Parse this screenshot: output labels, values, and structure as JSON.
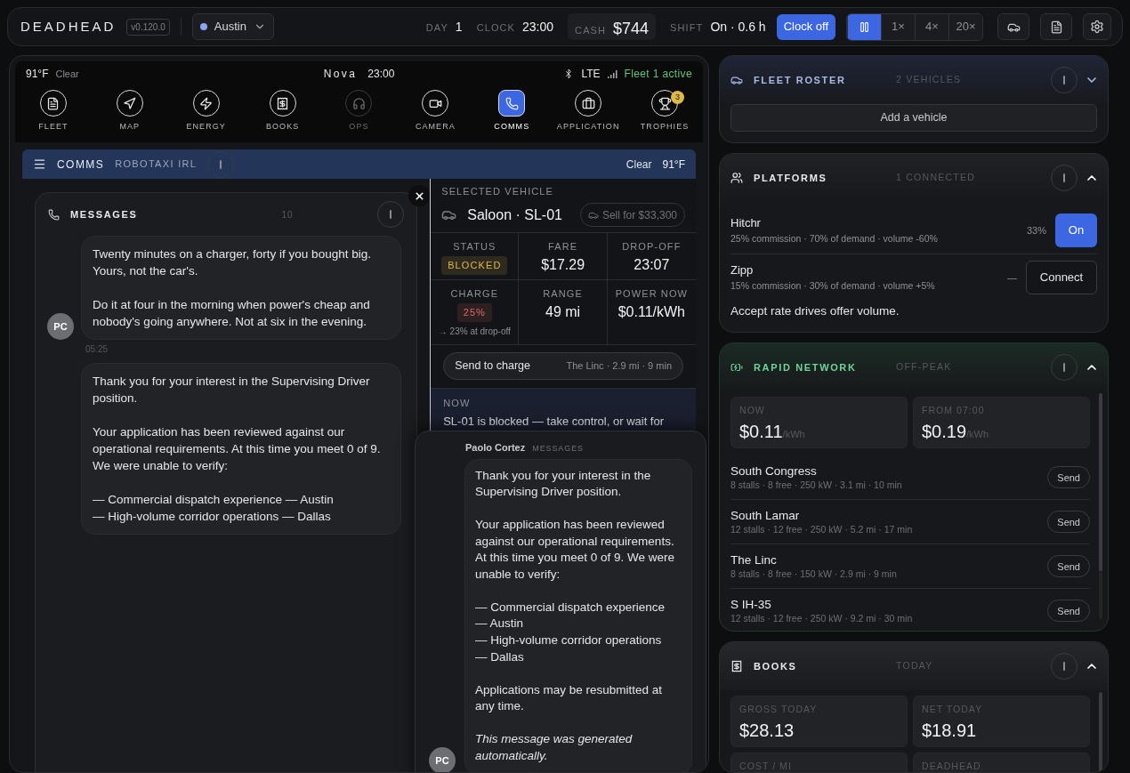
{
  "app": {
    "name": "DEADHEAD",
    "version": "v0.120.0"
  },
  "city": {
    "name": "Austin",
    "color": "#8aa4f8"
  },
  "stats": [
    {
      "kind": "plain",
      "label": "DAY",
      "value": "1"
    },
    {
      "kind": "plain",
      "label": "CLOCK",
      "value": "23:00"
    },
    {
      "kind": "boxed",
      "label": "CASH",
      "value": "$744"
    },
    {
      "kind": "plain",
      "label": "SHIFT",
      "value": "On · 0.6 h"
    }
  ],
  "clock_button": "Clock off",
  "speeds": [
    {
      "kind": "pause",
      "selected": true
    },
    {
      "kind": "rate",
      "label": "1×",
      "selected": false
    },
    {
      "kind": "rate",
      "label": "4×",
      "selected": false
    },
    {
      "kind": "rate",
      "label": "20×",
      "selected": false
    }
  ],
  "status_bar": {
    "temp": "91°F",
    "weather": "Clear",
    "carrier": "Nova",
    "time": "23:00",
    "network": "LTE",
    "fleet": "Fleet 1 active"
  },
  "nav": [
    {
      "kind": "fleet",
      "label": "FLEET",
      "selected": false,
      "disabled": false
    },
    {
      "kind": "map",
      "label": "MAP",
      "selected": false,
      "disabled": false
    },
    {
      "kind": "energy",
      "label": "ENERGY",
      "selected": false,
      "disabled": false
    },
    {
      "kind": "books",
      "label": "BOOKS",
      "selected": false,
      "disabled": false
    },
    {
      "kind": "ops",
      "label": "OPS",
      "selected": false,
      "disabled": true
    },
    {
      "kind": "camera",
      "label": "CAMERA",
      "selected": false,
      "disabled": false
    },
    {
      "kind": "comms",
      "label": "COMMS",
      "selected": true,
      "disabled": false
    },
    {
      "kind": "application",
      "label": "APPLICATION",
      "selected": false,
      "disabled": false
    },
    {
      "kind": "trophies",
      "label": "TROPHIES",
      "selected": false,
      "disabled": false,
      "badge": "3"
    }
  ],
  "section_bar": {
    "title": "COMMS",
    "subtitle": "ROBOTAXI IRL",
    "weather": "Clear",
    "temp": "91°F"
  },
  "messages": {
    "title": "MESSAGES",
    "count": "10",
    "items": [
      {
        "paragraphs": [
          "Twenty minutes on a charger, forty if you bought big. Yours, not the car's.",
          "Do it at four in the morning when power's cheap and nobody's going anywhere. Not at six in the evening."
        ],
        "avatar": "PC",
        "time": "05:25"
      },
      {
        "paragraphs": [
          "Thank you for your interest in the Supervising Driver position.",
          "Your application has been reviewed against our operational requirements. At this time you meet 0 of 9. We were unable to verify:",
          "— Commercial dispatch experience — Austin\n— High-volume corridor operations — Dallas"
        ]
      }
    ]
  },
  "vehicle": {
    "heading": "SELECTED VEHICLE",
    "name": "Saloon · SL-01",
    "sell": "Sell for $33,300",
    "stats": [
      {
        "kind": "badge",
        "label": "STATUS",
        "value": "BLOCKED",
        "color": "#e0b84a"
      },
      {
        "kind": "value",
        "label": "FARE",
        "value": "$17.29"
      },
      {
        "kind": "value",
        "label": "DROP-OFF",
        "value": "23:07"
      },
      {
        "kind": "badge",
        "label": "CHARGE",
        "value": "25%",
        "color": "#e06a6a",
        "note": "→ 23% at drop-off"
      },
      {
        "kind": "value",
        "label": "RANGE",
        "value": "49 mi"
      },
      {
        "kind": "value",
        "label": "POWER NOW",
        "value": "$0.11/kWh"
      }
    ],
    "charge_button": "Send to charge",
    "charge_target": "The Linc · 2.9 mi · 9 min",
    "now_label": "NOW",
    "now_text": "SL-01 is blocked — take control, or wait for"
  },
  "popup": {
    "sender": "Paolo Cortez",
    "tag": "MESSAGES",
    "avatar": "PC",
    "paragraphs": [
      "Thank you for your interest in the Supervising Driver position.",
      "Your application has been reviewed against our operational requirements. At this time you meet 0 of 9. We were unable to verify:",
      "— Commercial dispatch experience\n— Austin\n— High-volume corridor operations\n— Dallas",
      "Applications may be resubmitted at any time."
    ],
    "footnote": "This message was generated automatically."
  },
  "panels": [
    {
      "kind": "roster",
      "title": "FLEET ROSTER",
      "meta": "2 VEHICLES",
      "expanded": false,
      "action": "Add a vehicle"
    },
    {
      "kind": "platforms",
      "title": "PLATFORMS",
      "meta": "1 CONNECTED",
      "expanded": true,
      "platforms": [
        {
          "name": "Hitchr",
          "detail": "25% commission · 70% of demand · volume -60%",
          "share": "33%",
          "button": "On",
          "connected": true
        },
        {
          "name": "Zipp",
          "detail": "15% commission · 30% of demand · volume +5%",
          "share": "—",
          "button": "Connect",
          "connected": false
        }
      ],
      "note": "Accept rate drives offer volume."
    },
    {
      "kind": "network",
      "title": "RAPID NETWORK",
      "meta": "OFF-PEAK",
      "expanded": true,
      "prices": [
        {
          "label": "NOW",
          "value": "$0.11",
          "unit": "/kWh"
        },
        {
          "label": "FROM 07:00",
          "value": "$0.19",
          "unit": "/kWh"
        }
      ],
      "stations": [
        {
          "name": "South Congress",
          "detail": "8 stalls · 8 free · 250 kW · 3.1 mi · 10 min",
          "action": "Send"
        },
        {
          "name": "South Lamar",
          "detail": "12 stalls · 12 free · 250 kW · 5.2 mi · 17 min",
          "action": "Send"
        },
        {
          "name": "The Linc",
          "detail": "8 stalls · 8 free · 150 kW · 2.9 mi · 9 min",
          "action": "Send"
        },
        {
          "name": "S IH-35",
          "detail": "12 stalls · 12 free · 250 kW · 9.2 mi · 30 min",
          "action": "Send"
        }
      ]
    },
    {
      "kind": "books",
      "title": "BOOKS",
      "meta": "TODAY",
      "expanded": true,
      "tiles": [
        {
          "label": "GROSS TODAY",
          "value": "$28.13"
        },
        {
          "label": "NET TODAY",
          "value": "$18.91"
        },
        {
          "label": "COST / MI"
        },
        {
          "label": "DEADHEAD"
        }
      ]
    }
  ]
}
